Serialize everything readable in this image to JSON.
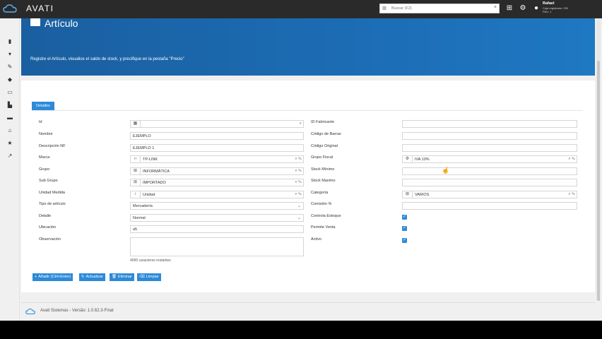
{
  "topbar": {
    "brand": "AVATI",
    "search_placeholder": "Buscar (F2)",
    "user_name": "Rafael",
    "user_sub1": "Caja registrado: 000",
    "user_sub2": "PAU: 1"
  },
  "sidebar": {
    "items": [
      "book-icon",
      "cart-icon",
      "wrench-icon",
      "cubes-icon",
      "money-icon",
      "industry-icon",
      "truck-icon",
      "bank-icon",
      "star-icon",
      "chart-icon"
    ]
  },
  "header": {
    "title": "Artículo",
    "description": "Registre el Artículo, visualice el saldo de stock, y precifique en la pestaña \"Precio\""
  },
  "tabs": {
    "detalles": "Detalles"
  },
  "left_form": {
    "id_label": "Id",
    "nombre_label": "Nombre",
    "nombre_value": "EJEMPLO",
    "descripcion_label": "Descripción NF",
    "descripcion_value": "EJEMPLO 1",
    "marca_label": "Marca",
    "marca_value": "TP-LINK",
    "grupo_label": "Grupo",
    "grupo_value": "INFORMÁTICA",
    "subgrupo_label": "Sub Grupo",
    "subgrupo_value": "IMPORTADO",
    "unidad_label": "Unidad Medida",
    "unidad_value": "Unidad",
    "tipo_label": "Tipo de artículo",
    "tipo_value": "Mercadería",
    "detalle_label": "Detalle",
    "detalle_value": "Normal",
    "ubicacion_label": "Ubicación",
    "ubicacion_value": "a5",
    "observacion_label": "Observación",
    "remaining": "4095 caracteres restantes"
  },
  "right_form": {
    "id_fabricante_label": "ID Fabricante",
    "codigo_barras_label": "Código de Barras",
    "codigo_original_label": "Código Original",
    "grupo_fiscal_label": "Grupo Fiscal",
    "grupo_fiscal_value": "IVA 10%",
    "stock_minimo_label": "Stock Mínimo",
    "stock_maximo_label": "Stock Maximo",
    "categoria_label": "Categoría",
    "categoria_value": "VARIOS",
    "comision_label": "Comisión %",
    "controla_label": "Controla Estoque",
    "permite_label": "Permite Venta",
    "activo_label": "Activo"
  },
  "buttons": {
    "add": "Añadir (Ctrl+Enter)",
    "update": "Actualizar",
    "delete": "Eliminar",
    "clear": "Limpiar"
  },
  "footer": {
    "text": "Avati Sistemas - Versão: 1.0.62.3-Final"
  },
  "colors": {
    "primary": "#2d8ad8",
    "header": "#1c6db5",
    "topbar": "#2a2a2a"
  }
}
